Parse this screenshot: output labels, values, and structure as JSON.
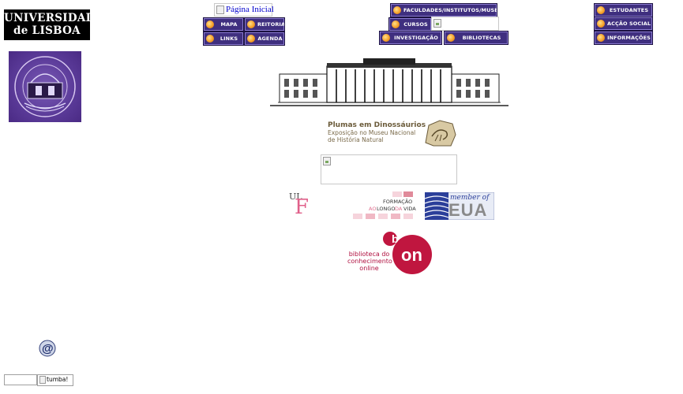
{
  "header": {
    "university_logo": "UNIVERSIDADE de LISBOA",
    "university_logo_line1": "UNIVERSIDADE",
    "university_logo_line2": "de LISBOA",
    "home_link": "Página Inicial"
  },
  "nav_left": [
    {
      "label": "MAPA"
    },
    {
      "label": "REITORIA"
    },
    {
      "label": "LINKS"
    },
    {
      "label": "AGENDA"
    }
  ],
  "nav_center": [
    {
      "label": "FACULDADES/INSTITUTOS/MUSEUS"
    },
    {
      "label": "CURSOS"
    },
    {
      "label": "INVESTIGAÇÃO"
    },
    {
      "label": "BIBLIOTECAS"
    }
  ],
  "nav_right": [
    {
      "label": "ESTUDANTES"
    },
    {
      "label": "ACÇÃO SOCIAL"
    },
    {
      "label": "INFORMAÇÕES"
    }
  ],
  "banners": {
    "dino_title": "Plumas em Dinossáurios",
    "dino_line1": "Exposição no Museu Nacional",
    "dino_line2": "de História Natural",
    "ulf_small": "UL",
    "ulf_big": "F",
    "flv_line1": "FORMAÇÃO",
    "flv_line2_a": "AO",
    "flv_line2_b": "LONGO",
    "flv_line2_c": "DA",
    "flv_line2_d": "VIDA",
    "eua_member": "member of",
    "eua_name": "EUA",
    "bon_line1": "biblioteca do",
    "bon_line2": "conhecimento",
    "bon_line3": "online",
    "bon_mark": "b-on"
  },
  "search": {
    "input_value": "",
    "button_alt": "tumba!"
  },
  "colors": {
    "nav_button_bg": "#3f2f7f",
    "nav_text": "#ffffff",
    "link_blue": "#0000cc",
    "bon_red": "#c0163f",
    "eua_blue": "#2b3f9a",
    "seal_purple": "#5a3a98"
  }
}
